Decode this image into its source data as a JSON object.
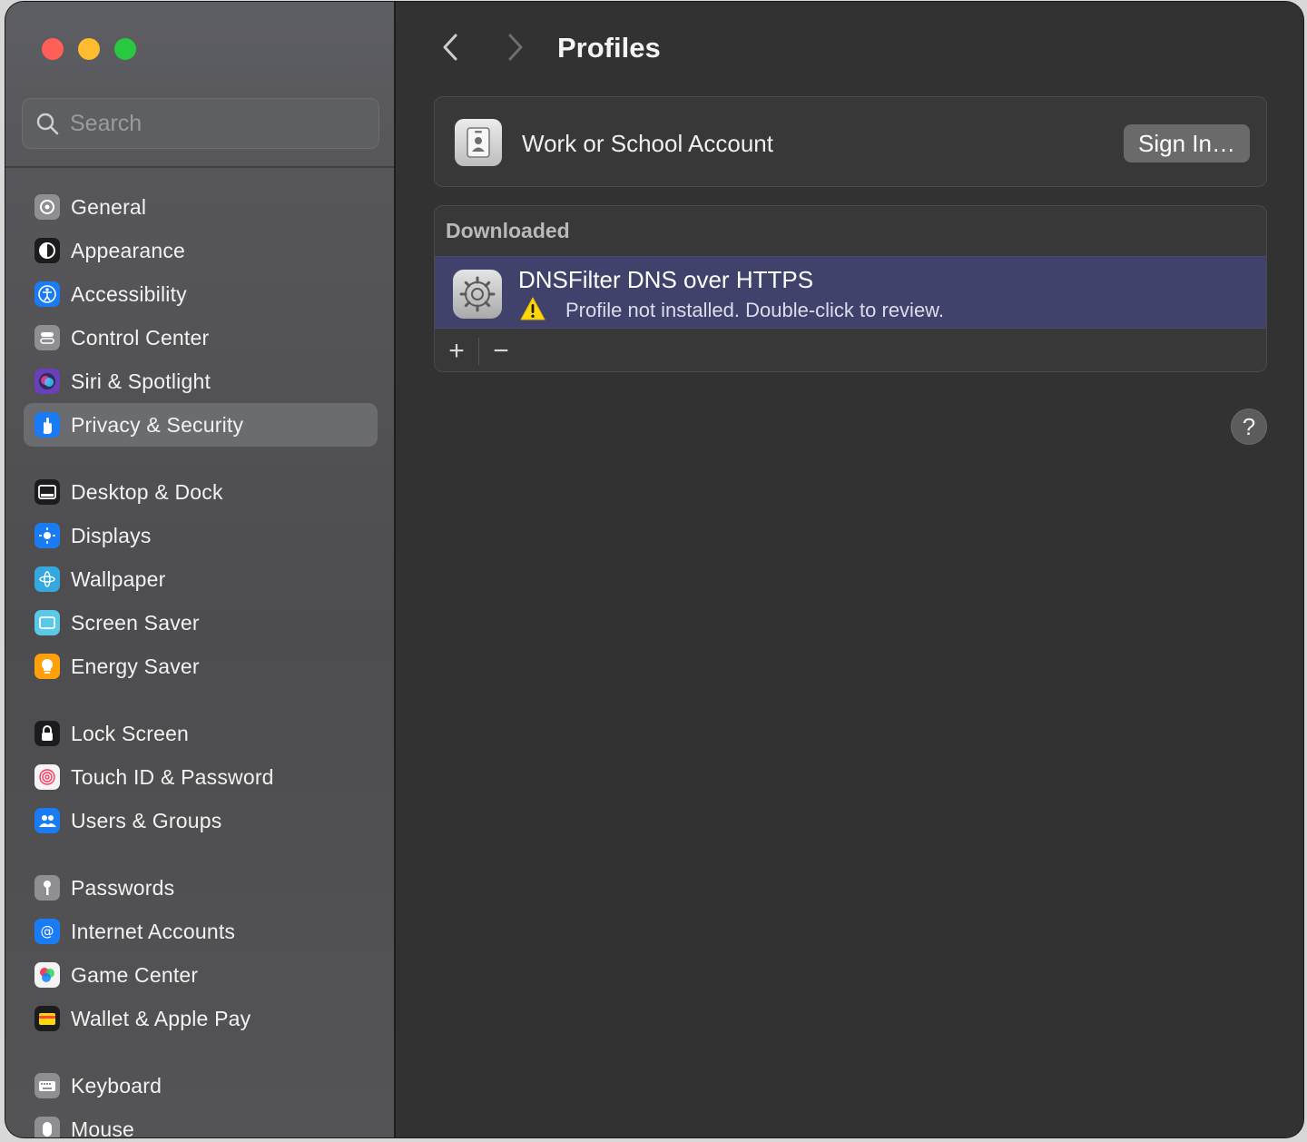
{
  "window": {
    "traffic_lights": {
      "close": "#ff5f57",
      "minimize": "#febc2e",
      "maximize": "#28c840"
    }
  },
  "search": {
    "placeholder": "Search",
    "icon": "magnifier-icon"
  },
  "sidebar": {
    "selected": "Privacy & Security",
    "groups": [
      [
        {
          "label": "General",
          "icon": "gear-icon",
          "color": "#8e8e93"
        },
        {
          "label": "Appearance",
          "icon": "appearance-icon",
          "color": "#1c1c1e"
        },
        {
          "label": "Accessibility",
          "icon": "accessibility-icon",
          "color": "#1a7cf5"
        },
        {
          "label": "Control Center",
          "icon": "control-center-icon",
          "color": "#8e8e93"
        },
        {
          "label": "Siri & Spotlight",
          "icon": "siri-icon",
          "color": "#6b3fb8"
        },
        {
          "label": "Privacy & Security",
          "icon": "hand-icon",
          "color": "#1a7cf5"
        }
      ],
      [
        {
          "label": "Desktop & Dock",
          "icon": "dock-icon",
          "color": "#1c1c1e"
        },
        {
          "label": "Displays",
          "icon": "sun-icon",
          "color": "#1a7cf5"
        },
        {
          "label": "Wallpaper",
          "icon": "flower-icon",
          "color": "#35a8e0"
        },
        {
          "label": "Screen Saver",
          "icon": "screen-saver-icon",
          "color": "#5ac8e8"
        },
        {
          "label": "Energy Saver",
          "icon": "lightbulb-icon",
          "color": "#ff9f0a"
        }
      ],
      [
        {
          "label": "Lock Screen",
          "icon": "lock-icon",
          "color": "#1c1c1e"
        },
        {
          "label": "Touch ID & Password",
          "icon": "fingerprint-icon",
          "color": "#f4f4f4"
        },
        {
          "label": "Users & Groups",
          "icon": "users-icon",
          "color": "#1a7cf5"
        }
      ],
      [
        {
          "label": "Passwords",
          "icon": "key-icon",
          "color": "#8e8e93"
        },
        {
          "label": "Internet Accounts",
          "icon": "at-icon",
          "color": "#1a7cf5"
        },
        {
          "label": "Game Center",
          "icon": "game-center-icon",
          "color": "#f4f4f4"
        },
        {
          "label": "Wallet & Apple Pay",
          "icon": "wallet-icon",
          "color": "#1c1c1e"
        }
      ],
      [
        {
          "label": "Keyboard",
          "icon": "keyboard-icon",
          "color": "#8e8e93"
        },
        {
          "label": "Mouse",
          "icon": "mouse-icon",
          "color": "#8e8e93"
        }
      ]
    ]
  },
  "header": {
    "title": "Profiles",
    "back_icon": "chevron-left-icon",
    "forward_icon": "chevron-right-icon"
  },
  "account": {
    "label": "Work or School Account",
    "button": "Sign In…",
    "icon": "id-badge-icon"
  },
  "downloaded": {
    "header": "Downloaded",
    "profile": {
      "name": "DNSFilter DNS over HTTPS",
      "status": "Profile not installed. Double-click to review.",
      "icon": "settings-gear-icon",
      "warning_icon": "warning-icon",
      "selected_color": "#40426b"
    },
    "add_button": "+",
    "remove_button": "−"
  },
  "help_button": "?"
}
